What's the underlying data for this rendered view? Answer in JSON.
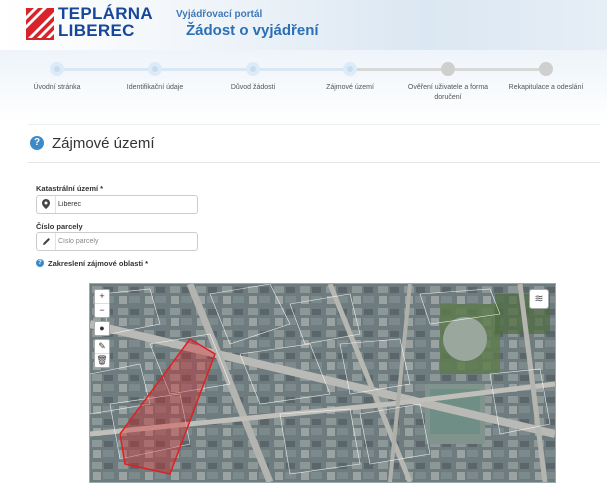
{
  "header": {
    "logo_line1": "TEPLÁRNA",
    "logo_line2": "LIBEREC",
    "portal_label": "Vyjádřovací portál",
    "page_title": "Žádost o vyjádření"
  },
  "steps": [
    {
      "label": "Úvodní stránka",
      "state": "done"
    },
    {
      "label": "Identifikační údaje",
      "state": "done"
    },
    {
      "label": "Důvod žádosti",
      "state": "done"
    },
    {
      "label": "Zájmové území",
      "state": "current"
    },
    {
      "label": "Ověření uživatele a forma doručení",
      "state": "todo"
    },
    {
      "label": "Rekapitulace a odeslání",
      "state": "todo"
    }
  ],
  "section": {
    "title": "Zájmové území",
    "help_icon": "question-circle-icon"
  },
  "form": {
    "cadastral_label": "Katastrální území *",
    "cadastral_value": "Liberec",
    "cadastral_icon": "map-marker-icon",
    "parcel_label": "Číslo parcely",
    "parcel_placeholder": "Číslo parcely",
    "parcel_icon": "pencil-icon",
    "area_label": "Zakreslení zájmové oblasti *"
  },
  "map": {
    "zoom_in": "+",
    "zoom_out": "−",
    "tools": [
      "polygon-tool-icon",
      "edit-tool-icon",
      "delete-tool-icon",
      "point-tool-icon"
    ],
    "layers_icon": "layers-icon",
    "highlight_color": "#e02020"
  },
  "colors": {
    "brand_blue": "#17469b",
    "brand_red": "#d8232a",
    "accent": "#3d8ac8"
  }
}
